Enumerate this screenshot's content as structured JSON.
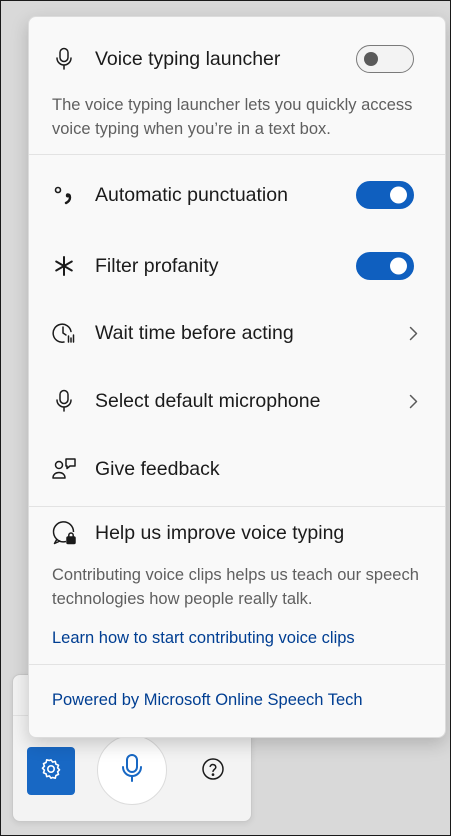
{
  "flyout": {
    "launcher": {
      "label": "Voice typing launcher",
      "toggle_on": false,
      "description": "The voice typing launcher lets you quickly access voice typing when you’re in a text box."
    },
    "items": [
      {
        "label": "Automatic punctuation",
        "icon": "punctuation-icon",
        "control": "toggle",
        "toggle_on": true
      },
      {
        "label": "Filter profanity",
        "icon": "asterisk-icon",
        "control": "toggle",
        "toggle_on": true
      },
      {
        "label": "Wait time before acting",
        "icon": "timer-icon",
        "control": "chevron"
      },
      {
        "label": "Select default microphone",
        "icon": "microphone-icon",
        "control": "chevron"
      },
      {
        "label": "Give feedback",
        "icon": "feedback-icon",
        "control": "none"
      }
    ],
    "improve": {
      "label": "Help us improve voice typing",
      "description": "Contributing voice clips helps us teach our speech technologies how people really talk.",
      "link": "Learn how to start contributing voice clips"
    },
    "footer_link": "Powered by Microsoft Online Speech Tech"
  },
  "colors": {
    "accent": "#0f5fbf",
    "settings_button": "#1868c4",
    "link": "#003e92",
    "description_text": "#5f5f5f"
  },
  "voice_bar": {
    "buttons": [
      "gear-icon",
      "microphone-icon",
      "help-icon"
    ]
  }
}
